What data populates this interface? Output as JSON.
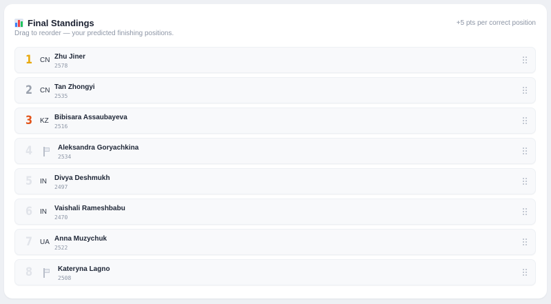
{
  "header": {
    "title": "Final Standings",
    "points_note": "+5 pts per correct position",
    "subtitle": "Drag to reorder — your predicted finishing positions."
  },
  "icons": {
    "title": "bar-chart-icon",
    "unknown_flag": "flag-icon",
    "drag": "drag-handle-icon"
  },
  "colors": {
    "gold": "#e8a80c",
    "silver": "#9aa1ad",
    "bronze": "#e2541a",
    "muted_rank": "#e1e4ea"
  },
  "players": [
    {
      "rank": "1",
      "country": "CN",
      "name": "Zhu Jiner",
      "rating": "2578",
      "medal": "gold"
    },
    {
      "rank": "2",
      "country": "CN",
      "name": "Tan Zhongyi",
      "rating": "2535",
      "medal": "silver"
    },
    {
      "rank": "3",
      "country": "KZ",
      "name": "Bibisara Assaubayeva",
      "rating": "2516",
      "medal": "bronze"
    },
    {
      "rank": "4",
      "country": "",
      "name": "Aleksandra Goryachkina",
      "rating": "2534",
      "medal": "none"
    },
    {
      "rank": "5",
      "country": "IN",
      "name": "Divya Deshmukh",
      "rating": "2497",
      "medal": "none"
    },
    {
      "rank": "6",
      "country": "IN",
      "name": "Vaishali Rameshbabu",
      "rating": "2470",
      "medal": "none"
    },
    {
      "rank": "7",
      "country": "UA",
      "name": "Anna Muzychuk",
      "rating": "2522",
      "medal": "none"
    },
    {
      "rank": "8",
      "country": "",
      "name": "Kateryna Lagno",
      "rating": "2508",
      "medal": "none"
    }
  ]
}
